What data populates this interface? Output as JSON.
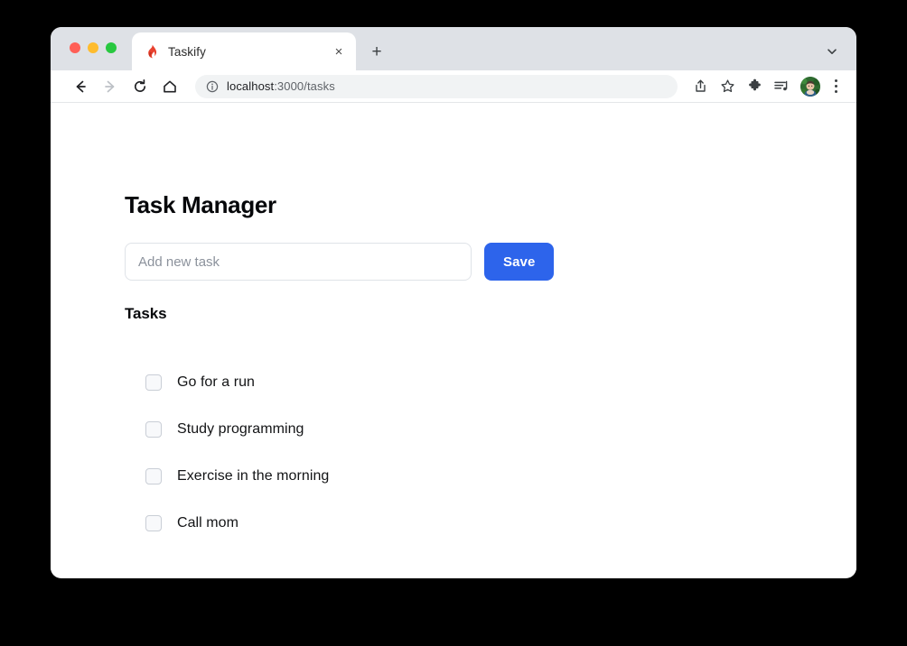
{
  "window": {
    "traffic_lights": [
      {
        "name": "close",
        "color": "#ff5f57"
      },
      {
        "name": "minimize",
        "color": "#febc2e"
      },
      {
        "name": "maximize",
        "color": "#28c840"
      }
    ]
  },
  "browser": {
    "tab": {
      "title": "Taskify",
      "favicon": "taskify-flame-favicon",
      "close_label": "×"
    },
    "new_tab_label": "+",
    "tab_search_icon": "chevron-down-icon",
    "nav": {
      "back_icon": "back-arrow-icon",
      "forward_icon": "forward-arrow-icon",
      "reload_icon": "reload-icon",
      "home_icon": "home-icon"
    },
    "omnibox": {
      "security_icon": "info-circle-icon",
      "url_host": "localhost",
      "url_path": ":3000/tasks",
      "full_url": "localhost:3000/tasks"
    },
    "actions": [
      {
        "name": "share-icon",
        "label": "Share"
      },
      {
        "name": "bookmark-star-icon",
        "label": "Bookmark"
      },
      {
        "name": "extensions-puzzle-icon",
        "label": "Extensions"
      },
      {
        "name": "media-playlist-icon",
        "label": "Media"
      }
    ],
    "profile": {
      "name": "profile-avatar",
      "label": "Profile"
    },
    "menu": {
      "name": "three-dot-menu",
      "label": "Customize and control"
    }
  },
  "page": {
    "title": "Task Manager",
    "add_task": {
      "placeholder": "Add new task",
      "value": "",
      "save_label": "Save"
    },
    "tasks_heading": "Tasks",
    "tasks": [
      {
        "label": "Go for a run",
        "checked": false
      },
      {
        "label": "Study programming",
        "checked": false
      },
      {
        "label": "Exercise in the morning",
        "checked": false
      },
      {
        "label": "Call mom",
        "checked": false
      }
    ]
  },
  "colors": {
    "accent": "#2d64eb",
    "tabstrip": "#dee1e6",
    "text": "#06070a",
    "placeholder": "#8c929c",
    "checkbox_border": "#c9ced6"
  }
}
